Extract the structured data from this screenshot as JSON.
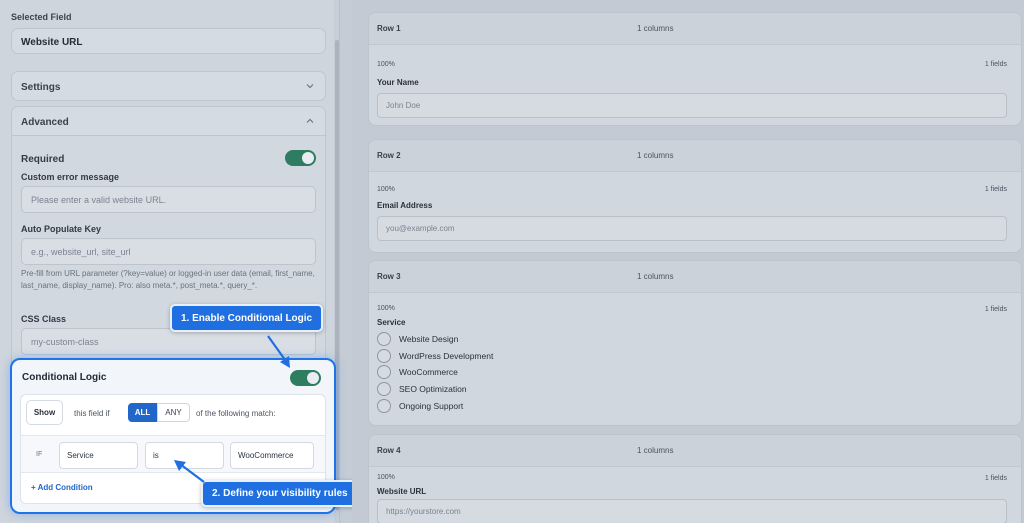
{
  "left": {
    "selected_field_label": "Selected Field",
    "selected_field_name": "Website URL",
    "settings_label": "Settings",
    "advanced_label": "Advanced",
    "required_label": "Required",
    "custom_error_label": "Custom error message",
    "custom_error_placeholder": "Please enter a valid website URL.",
    "auto_populate_label": "Auto Populate Key",
    "auto_populate_placeholder": "e.g., website_url, site_url",
    "auto_populate_help": "Pre-fill from URL parameter (?key=value) or logged-in user data (email, first_name, last_name, display_name). Pro: also meta.*, post_meta.*, query_*.",
    "css_class_label": "CSS Class",
    "css_class_placeholder": "my-custom-class",
    "conditional": {
      "title": "Conditional Logic",
      "show_label": "Show",
      "this_field_if": "this field if",
      "all_label": "ALL",
      "any_label": "ANY",
      "of_following": "of the following match:",
      "if_label": "IF",
      "rule_field": "Service",
      "rule_operator": "is",
      "rule_value": "WooCommerce",
      "add_condition": "+ Add Condition"
    }
  },
  "callouts": {
    "step1": "1. Enable Conditional Logic",
    "step2": "2. Define your visibility rules"
  },
  "rows": [
    {
      "title": "Row 1",
      "columns": "1 columns",
      "width": "100%",
      "fields": "1 fields",
      "label": "Your Name",
      "placeholder": "John Doe"
    },
    {
      "title": "Row 2",
      "columns": "1 columns",
      "width": "100%",
      "fields": "1 fields",
      "label": "Email Address",
      "placeholder": "you@example.com"
    },
    {
      "title": "Row 3",
      "columns": "1 columns",
      "width": "100%",
      "fields": "1 fields",
      "label": "Service",
      "options": [
        "Website Design",
        "WordPress Development",
        "WooCommerce",
        "SEO Optimization",
        "Ongoing Support"
      ]
    },
    {
      "title": "Row 4",
      "columns": "1 columns",
      "width": "100%",
      "fields": "1 fields",
      "label": "Website URL",
      "placeholder": "https://yourstore.com"
    }
  ],
  "colors": {
    "accent": "#1f6fe0",
    "toggle_on": "#2f7d60"
  },
  "icons": [
    "chevron-down-icon",
    "chevron-up-icon",
    "arrow-icon"
  ]
}
